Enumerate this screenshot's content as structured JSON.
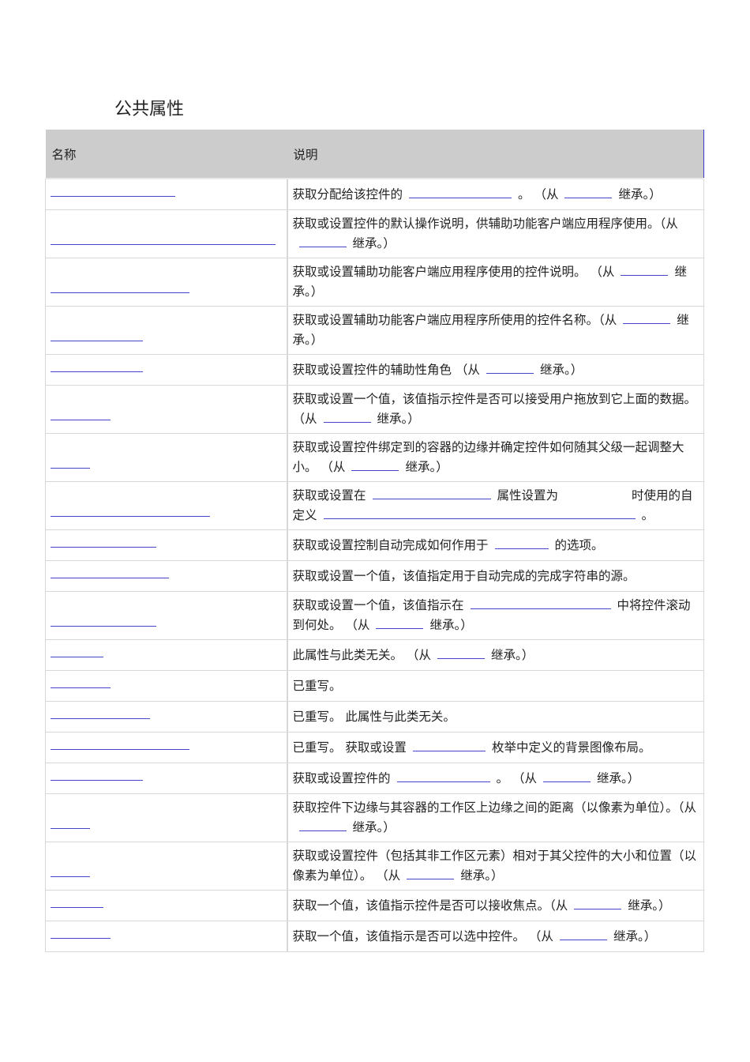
{
  "title": "公共属性",
  "headers": {
    "name": "名称",
    "desc": "说明"
  },
  "rows": [
    {
      "desc": [
        "获取分配给该控件的",
        "。 （从",
        "继承。）"
      ]
    },
    {
      "desc": [
        "获取或设置控件的默认操作说明，供辅助功能客户端应用程序使用。（从",
        "继承。）"
      ]
    },
    {
      "desc": [
        "获取或设置辅助功能客户端应用程序使用的控件说明。 （从",
        "继承。）"
      ]
    },
    {
      "desc": [
        "获取或设置辅助功能客户端应用程序所使用的控件名称。（从",
        "继承。）"
      ]
    },
    {
      "desc": [
        "获取或设置控件的辅助性角色 （从",
        "继承。）"
      ]
    },
    {
      "desc": [
        "获取或设置一个值，该值指示控件是否可以接受用户拖放到它上面的数据。 （从",
        "继承。）"
      ]
    },
    {
      "desc": [
        "获取或设置控件绑定到的容器的边缘并确定控件如何随其父级一起调整大小。 （从",
        "继承。）"
      ]
    },
    {
      "desc": [
        "获取或设置在",
        "属性设置为　　　　　　时使用的自定义",
        "。"
      ]
    },
    {
      "desc": [
        "获取或设置控制自动完成如何作用于",
        "的选项。"
      ]
    },
    {
      "desc": [
        "获取或设置一个值，该值指定用于自动完成的完成字符串的源。"
      ]
    },
    {
      "desc": [
        "获取或设置一个值，该值指示在",
        "中将控件滚动到何处。 （从",
        "继承。）"
      ]
    },
    {
      "desc": [
        "此属性与此类无关。 （从",
        "继承。）"
      ]
    },
    {
      "desc": [
        "已重写。"
      ]
    },
    {
      "desc": [
        "已重写。 此属性与此类无关。"
      ]
    },
    {
      "desc": [
        "已重写。 获取或设置",
        "枚举中定义的背景图像布局。"
      ]
    },
    {
      "desc": [
        "获取或设置控件的",
        "。 （从",
        "继承。）"
      ]
    },
    {
      "desc": [
        "获取控件下边缘与其容器的工作区上边缘之间的距离（以像素为单位）。（从",
        "继承。）"
      ]
    },
    {
      "desc": [
        "获取或设置控件（包括其非工作区元素）相对于其父控件的大小和位置（以像素为单位）。 （从",
        "继承。）"
      ]
    },
    {
      "desc": [
        "获取一个值，该值指示控件是否可以接收焦点。（从",
        "继承。）"
      ]
    },
    {
      "desc": [
        "获取一个值，该值指示是否可以选中控件。 （从",
        "继承。）"
      ]
    }
  ]
}
